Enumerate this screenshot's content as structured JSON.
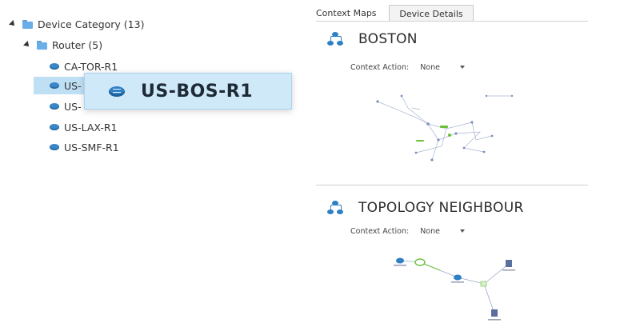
{
  "tree": {
    "root": {
      "label": "Device Category (13)"
    },
    "group": {
      "label": "Router (5)"
    },
    "items": [
      {
        "label": "CA-TOR-R1"
      },
      {
        "label": "US-"
      },
      {
        "label": "US-"
      },
      {
        "label": "US-LAX-R1"
      },
      {
        "label": "US-SMF-R1"
      }
    ]
  },
  "drag_tooltip": {
    "label": "US-BOS-R1"
  },
  "tabs": [
    {
      "label": "Context Maps"
    },
    {
      "label": "Device Details"
    }
  ],
  "maps": [
    {
      "title": "BOSTON",
      "context_action_label": "Context Action:",
      "context_action_value": "None"
    },
    {
      "title": "TOPOLOGY NEIGHBOUR",
      "context_action_label": "Context Action:",
      "context_action_value": "None"
    }
  ],
  "colors": {
    "selection": "#bfdff5",
    "tooltip_bg": "#cfe9f9",
    "icon_blue": "#2f7fc4",
    "link_green": "#6abf3a"
  },
  "icons": {
    "expander": "triangle-expander-icon",
    "folder": "folder-icon",
    "router": "router-icon",
    "topology": "topology-icon",
    "dropdown": "chevron-down-icon"
  }
}
